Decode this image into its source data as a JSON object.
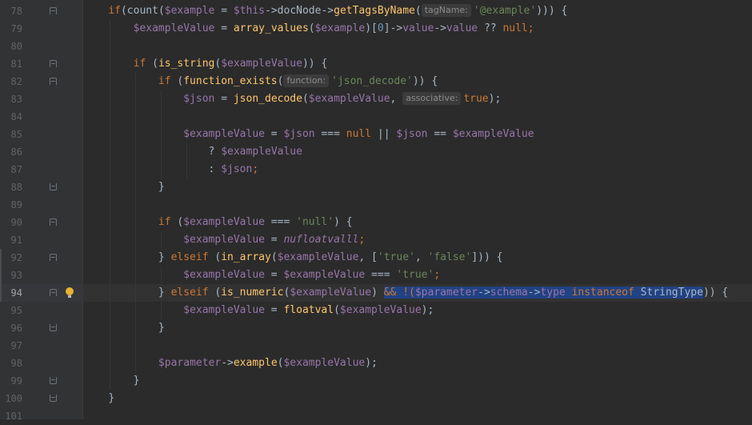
{
  "editor": {
    "lines": [
      {
        "num": "78"
      },
      {
        "num": "79"
      },
      {
        "num": "80"
      },
      {
        "num": "81"
      },
      {
        "num": "82"
      },
      {
        "num": "83"
      },
      {
        "num": "84"
      },
      {
        "num": "85"
      },
      {
        "num": "86"
      },
      {
        "num": "87"
      },
      {
        "num": "88"
      },
      {
        "num": "89"
      },
      {
        "num": "90"
      },
      {
        "num": "91"
      },
      {
        "num": "92"
      },
      {
        "num": "93"
      },
      {
        "num": "94"
      },
      {
        "num": "95"
      },
      {
        "num": "96"
      },
      {
        "num": "97"
      },
      {
        "num": "98"
      },
      {
        "num": "99"
      },
      {
        "num": "100"
      },
      {
        "num": "101"
      }
    ],
    "hints": {
      "tag_name": "tagName:",
      "function": "function:",
      "associative": "associative:"
    },
    "colors": {
      "background": "#2b2b2b",
      "keyword": "#cc7832",
      "variable": "#9876aa",
      "function": "#ffc66d",
      "string": "#6a8759",
      "number": "#6897bb",
      "selection": "#214283",
      "bulb": "#e8b331"
    },
    "icons": [
      "fold-icon",
      "lightbulb-icon"
    ],
    "code": {
      "l78": [
        "if",
        "(",
        "count",
        "(",
        "$example",
        " = ",
        "$this",
        "->",
        "docNode",
        "->",
        "getTagsByName",
        "(",
        "'@example'",
        "))) {"
      ],
      "l79": [
        "$exampleValue",
        " = ",
        "array_values",
        "(",
        "$example",
        ")[",
        "0",
        "]->",
        "value",
        "->",
        "value",
        " ?? ",
        "null",
        ";"
      ],
      "l81": [
        "if",
        " (",
        "is_string",
        "(",
        "$exampleValue",
        ")) {"
      ],
      "l82": [
        "if",
        " (",
        "function_exists",
        "(",
        "'json_decode'",
        ")) {"
      ],
      "l83": [
        "$json",
        " = ",
        "json_decode",
        "(",
        "$exampleValue",
        ", ",
        "true",
        ");"
      ],
      "l85": [
        "$exampleValue",
        " = ",
        "$json",
        " === ",
        "null",
        " || ",
        "$json",
        " == ",
        "$exampleValue"
      ],
      "l86": [
        "? ",
        "$exampleValue"
      ],
      "l87": [
        ": ",
        "$json",
        ";"
      ],
      "l88": [
        "}"
      ],
      "l90": [
        "if",
        " (",
        "$exampleValue",
        " === ",
        "'null'",
        ") {"
      ],
      "l91": [
        "$exampleValue",
        " = ",
        "nufloatvalll",
        ";"
      ],
      "l92": [
        "} ",
        "elseif",
        " (",
        "in_array",
        "(",
        "$exampleValue",
        ", [",
        "'true'",
        ", ",
        "'false'",
        "])) {"
      ],
      "l93": [
        "$exampleValue",
        " = ",
        "$exampleValue",
        " === ",
        "'true'",
        ";"
      ],
      "l94": [
        "} ",
        "elseif",
        " (",
        "is_numeric",
        "(",
        "$exampleValue",
        ") ",
        "&& !(",
        "$parameter",
        "->",
        "schema",
        "->",
        "type",
        " ",
        "instanceof",
        " ",
        "StringType",
        ")",
        ") {"
      ],
      "l95": [
        "$exampleValue",
        " = ",
        "floatval",
        "(",
        "$exampleValue",
        ");"
      ],
      "l96": [
        "}"
      ],
      "l98": [
        "$parameter",
        "->",
        "example",
        "(",
        "$exampleValue",
        ");"
      ],
      "l99": [
        "}"
      ],
      "l100": [
        "}"
      ]
    }
  }
}
